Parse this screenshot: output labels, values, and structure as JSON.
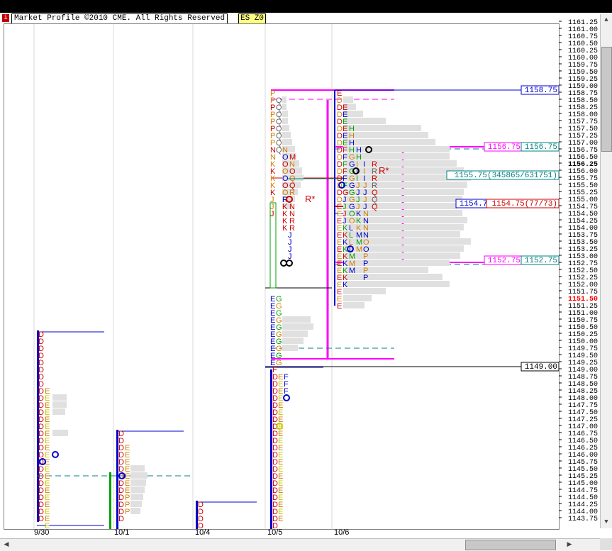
{
  "header": {
    "icon": "i",
    "title": "Market Profile ©2010 CME. All Rights Reserved",
    "symbol": "ES Z0"
  },
  "axis": {
    "prices": [
      "1161.25",
      "1161.00",
      "1160.75",
      "1160.50",
      "1160.25",
      "1160.00",
      "1159.75",
      "1159.50",
      "1159.25",
      "1159.00",
      "1158.75",
      "1158.50",
      "1158.25",
      "1158.00",
      "1157.75",
      "1157.50",
      "1157.25",
      "1157.00",
      "1156.75",
      "1156.50",
      "1156.25",
      "1156.00",
      "1155.75",
      "1155.50",
      "1155.25",
      "1155.00",
      "1154.75",
      "1154.50",
      "1154.25",
      "1154.00",
      "1153.75",
      "1153.50",
      "1153.25",
      "1153.00",
      "1152.75",
      "1152.50",
      "1152.25",
      "1152.00",
      "1151.75",
      "1151.50",
      "1151.25",
      "1151.00",
      "1150.75",
      "1150.50",
      "1150.25",
      "1150.00",
      "1149.75",
      "1149.50",
      "1149.25",
      "1149.00",
      "1148.75",
      "1148.50",
      "1148.25",
      "1148.00",
      "1147.75",
      "1147.50",
      "1147.25",
      "1147.00",
      "1146.75",
      "1146.50",
      "1146.25",
      "1146.00",
      "1145.75",
      "1145.50",
      "1145.25",
      "1145.00",
      "1144.75",
      "1144.50",
      "1144.25",
      "1144.00",
      "1143.75"
    ],
    "current_price": "1151.50",
    "highlight_price": "1156.25",
    "colors": {
      "current": "#ff0000",
      "text": "#000000"
    }
  },
  "dates": [
    "9/30",
    "10/1",
    "10/4",
    "10/5",
    "10/6"
  ],
  "labels": {
    "hi": "1158.75",
    "vah_magenta": "1156.75",
    "vah_teal": "1156.75",
    "poc_vol": "1155.75(345865/631751)",
    "mid_blue": "1154.75",
    "poc_red": "1154.75(77/73)",
    "val_magenta": "1152.75",
    "val_teal": "1152.75",
    "low": "1149.00",
    "ib_star1": "R*",
    "ib_star2": "R*"
  },
  "colors": {
    "blue": "#0000cc",
    "red": "#cc0000",
    "magenta": "#ff00ff",
    "teal": "#008080",
    "green": "#00a000",
    "orange": "#d08000",
    "yellow": "#c8c800",
    "gray": "#e0e0e0",
    "pink_letter": "#c04040"
  },
  "chart_data": {
    "type": "market-profile",
    "symbol": "ES Z0",
    "y_range": [
      1143.75,
      1161.25
    ],
    "tick_size": 0.25,
    "sessions": [
      {
        "date": "9/30",
        "high": 1150.25,
        "low": 1143.75,
        "vah_line": 1150.25,
        "poc": 1145.25
      },
      {
        "date": "10/1",
        "high": 1146.75,
        "low": 1143.25,
        "vah_line": 1146.75,
        "poc": 1145.25
      },
      {
        "date": "10/4",
        "high": 1144.25,
        "low": 1143.5,
        "vah_line": 1144.25
      },
      {
        "date": "10/5",
        "high": 1158.75,
        "low": 1143.5,
        "value_area_high": 1158.75,
        "value_area_low": 1149.25,
        "poc": 1155.75
      },
      {
        "date": "10/6",
        "high": 1158.75,
        "low": 1151.25,
        "value_area_high": 1156.75,
        "value_area_low": 1152.75,
        "poc": 1155.75,
        "poc_volume": "345865/631751",
        "mid": 1154.75,
        "tpo_poc": "77/73"
      }
    ],
    "reference_lines": [
      {
        "price": 1158.75,
        "label": "1158.75",
        "color": "blue"
      },
      {
        "price": 1156.75,
        "label": "1156.75",
        "color": "magenta"
      },
      {
        "price": 1156.75,
        "label": "1156.75",
        "color": "teal"
      },
      {
        "price": 1155.75,
        "label": "1155.75(345865/631751)",
        "color": "teal"
      },
      {
        "price": 1154.75,
        "label": "1154.75",
        "color": "blue"
      },
      {
        "price": 1154.75,
        "label": "1154.75(77/73)",
        "color": "red"
      },
      {
        "price": 1152.75,
        "label": "1152.75",
        "color": "magenta"
      },
      {
        "price": 1152.75,
        "label": "1152.75",
        "color": "teal"
      },
      {
        "price": 1149.0,
        "label": "1149.00",
        "color": "black"
      }
    ],
    "current_price": 1151.5
  }
}
